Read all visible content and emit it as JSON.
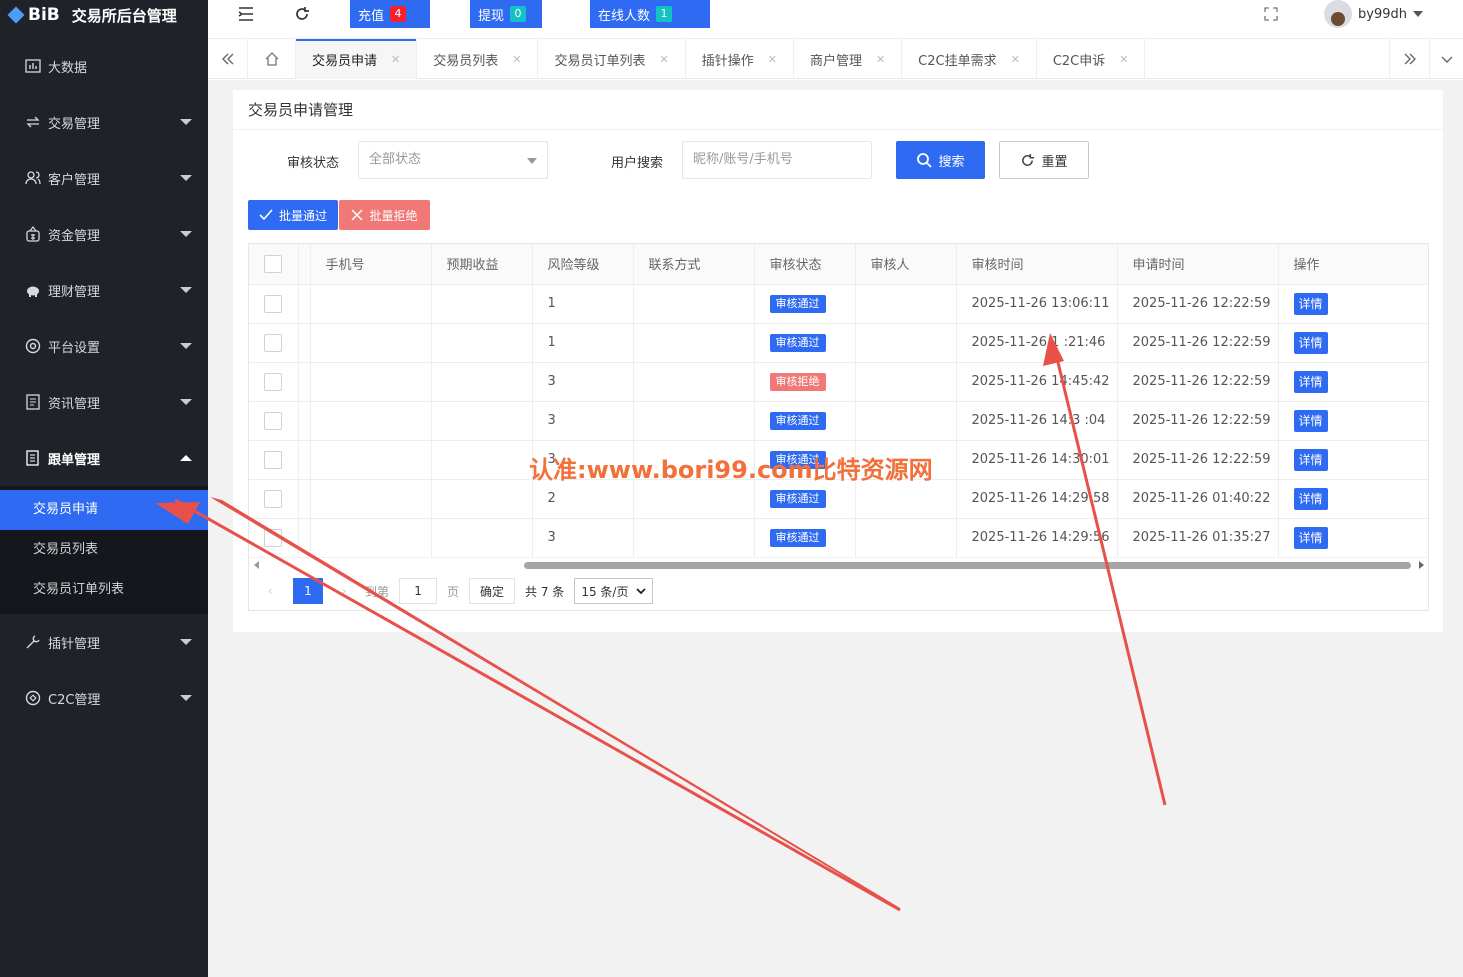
{
  "app": {
    "logo": "BiB",
    "title": "交易所后台管理"
  },
  "sidebar": {
    "items": [
      {
        "label": "大数据",
        "icon": "chart-icon",
        "caret": false
      },
      {
        "label": "交易管理",
        "icon": "exchange-icon",
        "caret": true
      },
      {
        "label": "客户管理",
        "icon": "users-icon",
        "caret": true
      },
      {
        "label": "资金管理",
        "icon": "wallet-icon",
        "caret": true
      },
      {
        "label": "理财管理",
        "icon": "piggy-icon",
        "caret": true
      },
      {
        "label": "平台设置",
        "icon": "settings-icon",
        "caret": true
      },
      {
        "label": "资讯管理",
        "icon": "news-icon",
        "caret": true
      },
      {
        "label": "跟单管理",
        "icon": "document-icon",
        "caret": true,
        "open": true
      }
    ],
    "submenu": [
      {
        "label": "交易员申请",
        "active": true
      },
      {
        "label": "交易员列表"
      },
      {
        "label": "交易员订单列表"
      }
    ],
    "items_after": [
      {
        "label": "插针管理",
        "icon": "wrench-icon",
        "caret": true
      },
      {
        "label": "C2C管理",
        "icon": "c2c-icon",
        "caret": true
      }
    ]
  },
  "topbar": {
    "recharge": {
      "label": "充值",
      "count": "4",
      "badge_color": "#f5222d"
    },
    "withdraw": {
      "label": "提现",
      "count": "0",
      "badge_color": "#13c2c2"
    },
    "online": {
      "label": "在线人数",
      "count": "1",
      "badge_color": "#13c2c2"
    },
    "username": "by99dh"
  },
  "tabs": [
    "交易员申请",
    "交易员列表",
    "交易员订单列表",
    "插针操作",
    "商户管理",
    "C2C挂单需求",
    "C2C申诉"
  ],
  "panel": {
    "title": "交易员申请管理",
    "filter": {
      "status_label": "审核状态",
      "status_value": "全部状态",
      "search_label": "用户搜索",
      "search_placeholder": "昵称/账号/手机号",
      "search_button": "搜索",
      "reset_button": "重置"
    },
    "batch_approve": "批量通过",
    "batch_reject": "批量拒绝"
  },
  "table": {
    "columns": [
      "手机号",
      "预期收益",
      "风险等级",
      "联系方式",
      "审核状态",
      "审核人",
      "审核时间",
      "申请时间",
      "操作"
    ],
    "rows": [
      {
        "phone": "",
        "income": "",
        "risk": "1",
        "contact": "",
        "status": "审核通过",
        "status_type": "ok",
        "reviewer": "",
        "review_time": "2025-11-26 13:06:11",
        "apply_time": "2025-11-26 12:22:59",
        "action": "详情"
      },
      {
        "phone": "",
        "income": "",
        "risk": "1",
        "contact": "",
        "status": "审核通过",
        "status_type": "ok",
        "reviewer": "",
        "review_time": "2025-11-26 1 :21:46",
        "apply_time": "2025-11-26 12:22:59",
        "action": "详情"
      },
      {
        "phone": "",
        "income": "",
        "risk": "3",
        "contact": "",
        "status": "审核拒绝",
        "status_type": "reject",
        "reviewer": "",
        "review_time": "2025-11-26 14:45:42",
        "apply_time": "2025-11-26 12:22:59",
        "action": "详情"
      },
      {
        "phone": "",
        "income": "",
        "risk": "3",
        "contact": "",
        "status": "审核通过",
        "status_type": "ok",
        "reviewer": "",
        "review_time": "2025-11-26 14:3 :04",
        "apply_time": "2025-11-26 12:22:59",
        "action": "详情"
      },
      {
        "phone": "",
        "income": "",
        "risk": "3",
        "contact": "",
        "status": "审核通过",
        "status_type": "ok",
        "reviewer": "",
        "review_time": "2025-11-26 14:30:01",
        "apply_time": "2025-11-26 12:22:59",
        "action": "详情"
      },
      {
        "phone": "",
        "income": "",
        "risk": "2",
        "contact": "",
        "status": "审核通过",
        "status_type": "ok",
        "reviewer": "",
        "review_time": "2025-11-26 14:29:58",
        "apply_time": "2025-11-26 01:40:22",
        "action": "详情"
      },
      {
        "phone": "",
        "income": "",
        "risk": "3",
        "contact": "",
        "status": "审核通过",
        "status_type": "ok",
        "reviewer": "",
        "review_time": "2025-11-26 14:29:56",
        "apply_time": "2025-11-26 01:35:27",
        "action": "详情"
      }
    ]
  },
  "pager": {
    "current": "1",
    "goto_label": "到第",
    "goto_value": "1",
    "page_label": "页",
    "confirm": "确定",
    "total": "共 7 条",
    "per_page": "15 条/页"
  },
  "watermark": "认准:www.bori99.com比特资源网",
  "colors": {
    "sidebar": "#20222a",
    "accent": "#2f6bf2",
    "reject": "#f07877",
    "arrow": "#e8504a"
  }
}
